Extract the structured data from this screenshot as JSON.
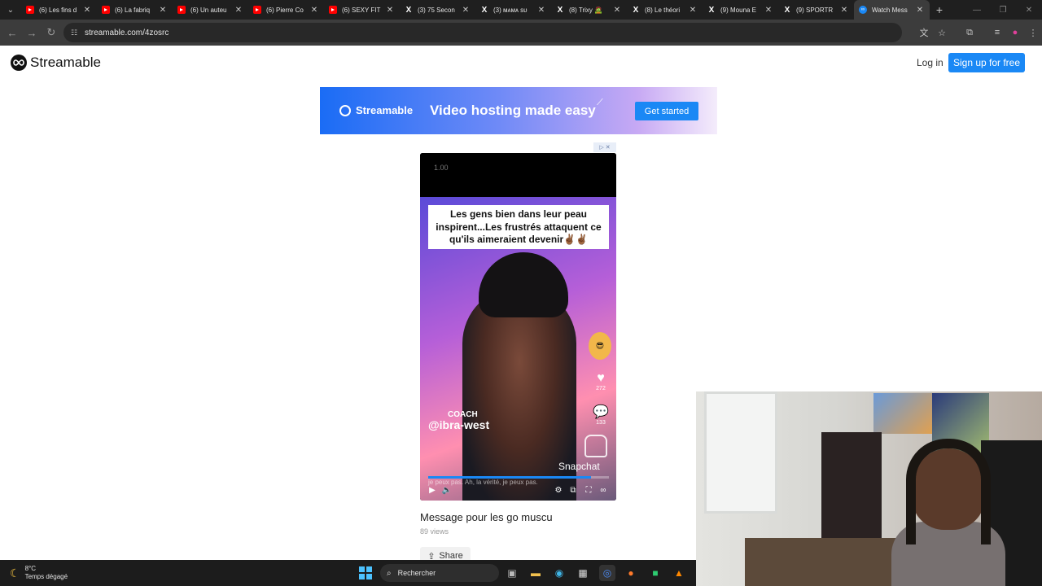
{
  "browser": {
    "tabs": [
      {
        "label": "(6) Les fins d",
        "icon": "youtube-icon"
      },
      {
        "label": "(6) La fabriq",
        "icon": "youtube-icon"
      },
      {
        "label": "(6) Un auteu",
        "icon": "youtube-icon"
      },
      {
        "label": "(6) Pierre Co",
        "icon": "youtube-icon"
      },
      {
        "label": "(6) SEXY FIT",
        "icon": "youtube-icon"
      },
      {
        "label": "(3) 75 Secon",
        "icon": "x-icon"
      },
      {
        "label": "(3) ᴍᴀᴍᴀ ѕυ",
        "icon": "x-icon"
      },
      {
        "label": "(8) Trixy 🧟",
        "icon": "x-icon"
      },
      {
        "label": "(8) Le théori",
        "icon": "x-icon"
      },
      {
        "label": "(9) Mouna E",
        "icon": "x-icon"
      },
      {
        "label": "(9) SPORTR",
        "icon": "x-icon"
      },
      {
        "label": "Watch Mess",
        "icon": "streamable-icon",
        "active": true
      }
    ],
    "url": "streamable.com/4zosrc"
  },
  "page": {
    "logo_text": "Streamable",
    "login_label": "Log in",
    "signup_label": "Sign up for free",
    "ad": {
      "logo_text": "Streamable",
      "headline": "Video hosting made easy",
      "cta": "Get started"
    },
    "player": {
      "time": "1.00",
      "caption": "Les gens bien dans leur peau inspirent...Les frustrés attaquent ce qu'ils aimeraient devenir✌🏾✌🏾",
      "coach_label": "COACH",
      "handle": "@ibra-west",
      "likes": "272",
      "comments": "133",
      "snap_label": "Snapchat",
      "subtitle": "je peux pas. Ah, la vérité, je peux pas.",
      "progress": 0.9
    },
    "video_title": "Message pour les go muscu",
    "views": "89 views",
    "share_label": "Share"
  },
  "taskbar": {
    "temperature": "8°C",
    "weather": "Temps dégagé",
    "search_label": "Rechercher"
  },
  "colors": {
    "accent": "#1a88f5",
    "tabbar": "#1f1f1f",
    "toolbar": "#3c3c3c"
  }
}
